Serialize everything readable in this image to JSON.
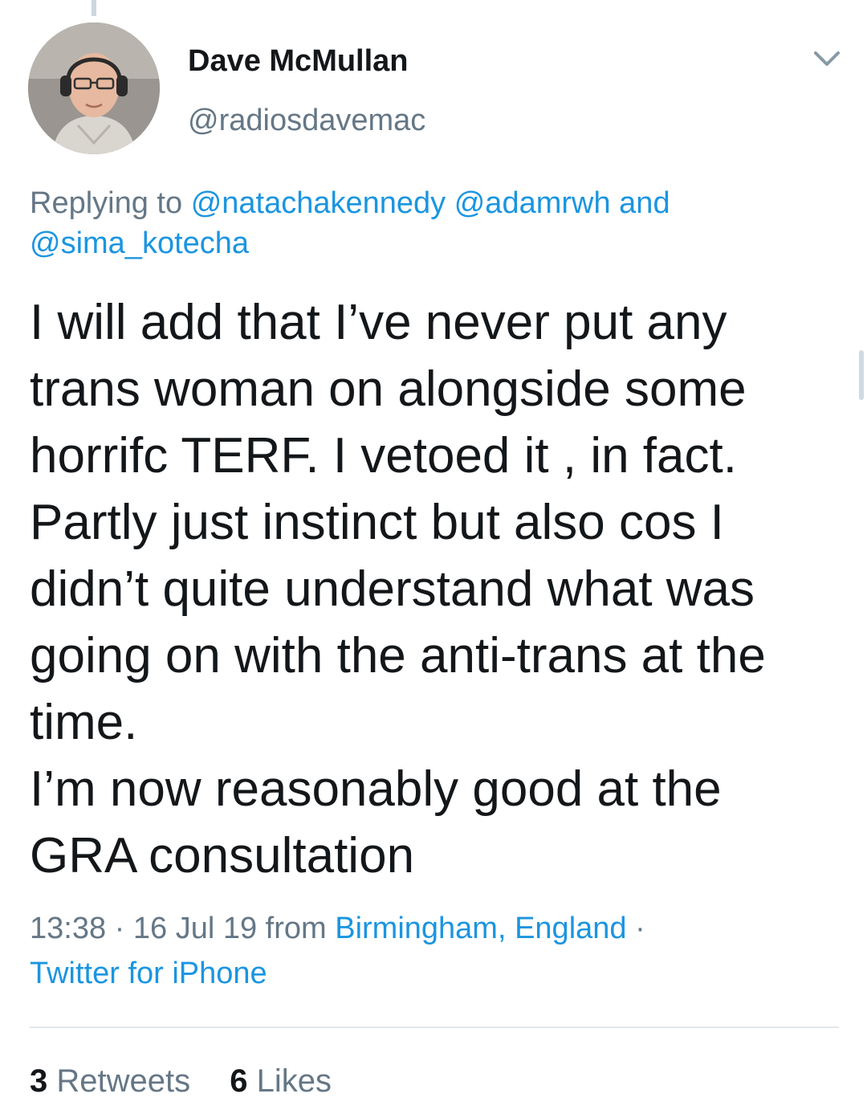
{
  "author": {
    "name": "Dave McMullan",
    "handle": "@radiosdavemac",
    "avatar_icon": "profile-photo"
  },
  "reply": {
    "prefix": "Replying to",
    "mentions": [
      "@natachakennedy",
      "@adamrwh",
      "@sima_kotecha"
    ],
    "conjunction": "and"
  },
  "tweet": {
    "lines": [
      "I will add that I’ve never put any",
      "trans woman on alongside some",
      "horrifc TERF. I vetoed it , in fact.",
      "Partly just instinct but also cos I",
      "didn’t quite understand what was",
      "going on with the anti-trans at the",
      "time.",
      "I’m now reasonably good at the",
      "GRA consultation"
    ]
  },
  "meta": {
    "time": "13:38",
    "date": "16 Jul 19",
    "from_label": "from",
    "location": "Birmingham, England",
    "separator": "·",
    "client": "Twitter for iPhone"
  },
  "stats": {
    "retweets_count": "3",
    "retweets_label": "Retweets",
    "likes_count": "6",
    "likes_label": "Likes"
  },
  "colors": {
    "text": "#14171a",
    "secondary": "#657786",
    "link": "#1b95e0",
    "divider": "#e1e8ed"
  },
  "icons": {
    "menu": "chevron-down-icon"
  }
}
